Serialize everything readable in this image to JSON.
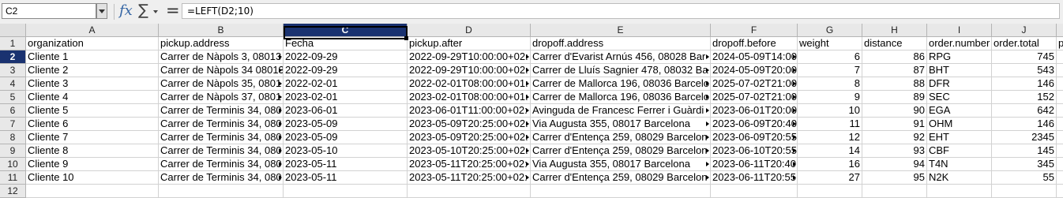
{
  "formula_bar": {
    "name_box": "C2",
    "formula": "=LEFT(D2;10)",
    "icons": [
      "fx-icon",
      "sigma-icon",
      "equals-icon"
    ]
  },
  "columns": [
    "A",
    "B",
    "C",
    "D",
    "E",
    "F",
    "G",
    "H",
    "I",
    "J"
  ],
  "selected_column": "C",
  "selected_row": 2,
  "row_numbers": [
    "1",
    "2",
    "3",
    "4",
    "5",
    "6",
    "7",
    "8",
    "9",
    "10",
    "11",
    "12"
  ],
  "headers": [
    "organization",
    "pickup.address",
    "Fecha",
    "pickup.after",
    "dropoff.address",
    "dropoff.before",
    "weight",
    "distance",
    "order.number",
    "order.total",
    "p"
  ],
  "rows": [
    [
      "Cliente 1",
      "Carrer de Nàpols 3, 08013",
      "2022-09-29",
      "2022-09-29T10:00:00+02:",
      "Carrer d'Evarist Arnús 456, 08028 Bar",
      "2024-05-09T14:00",
      "6",
      "86",
      "RPG",
      "745"
    ],
    [
      "Cliente 2",
      "Carrer de Nàpols 34 08013",
      "2022-09-29",
      "2022-09-29T10:00:00+02:",
      "Carrer de Lluís Sagnier 478, 08032 Ba",
      "2024-05-09T20:00",
      "7",
      "87",
      "BHT",
      "543"
    ],
    [
      "Cliente 3",
      "Carrer de Nàpols 35, 0801",
      "2022-02-01",
      "2022-02-01T08:00:00+01:",
      "Carrer de Mallorca 196, 08036 Barcelo",
      "2025-07-02T21:00",
      "8",
      "88",
      "DFR",
      "146"
    ],
    [
      "Cliente 4",
      "Carrer de Nàpols 37, 0801",
      "2023-02-01",
      "2023-02-01T08:00:00+01:",
      "Carrer de Mallorca 196, 08036 Barcelo",
      "2025-07-02T21:00",
      "9",
      "89",
      "SEC",
      "152"
    ],
    [
      "Cliente 5",
      "Carrer de Terminis 34, 080",
      "2023-06-01",
      "2023-06-01T11:00:00+02:",
      "Avinguda de Francesc Ferrer i Guàrdi",
      "2023-06-01T20:00",
      "10",
      "90",
      "EGA",
      "642"
    ],
    [
      "Cliente 6",
      "Carrer de Terminis 34, 080",
      "2023-05-09",
      "2023-05-09T20:25:00+02:",
      "Via Augusta 355, 08017 Barcelona",
      "2023-06-09T20:40",
      "11",
      "91",
      "OHM",
      "146"
    ],
    [
      "Cliente 7",
      "Carrer de Terminis 34, 080",
      "2023-05-09",
      "2023-05-09T20:25:00+02:",
      "Carrer d'Entença 259, 08029 Barcelon",
      "2023-06-09T20:55",
      "12",
      "92",
      "EHT",
      "2345"
    ],
    [
      "Cliente 8",
      "Carrer de Terminis 34, 080",
      "2023-05-10",
      "2023-05-10T20:25:00+02:",
      "Carrer d'Entença 259, 08029 Barcelon",
      "2023-06-10T20:55",
      "14",
      "93",
      "CBF",
      "145"
    ],
    [
      "Cliente 9",
      "Carrer de Terminis 34, 080",
      "2023-05-11",
      "2023-05-11T20:25:00+02:",
      "Via Augusta 355, 08017 Barcelona",
      "2023-06-11T20:40",
      "16",
      "94",
      "T4N",
      "345"
    ],
    [
      "Cliente 10",
      "Carrer de Terminis 34, 080",
      "2023-05-11",
      "2023-05-11T20:25:00+02:",
      "Carrer d'Entença 259, 08029 Barcelon",
      "2023-06-11T20:55",
      "27",
      "95",
      "N2K",
      "55"
    ]
  ]
}
